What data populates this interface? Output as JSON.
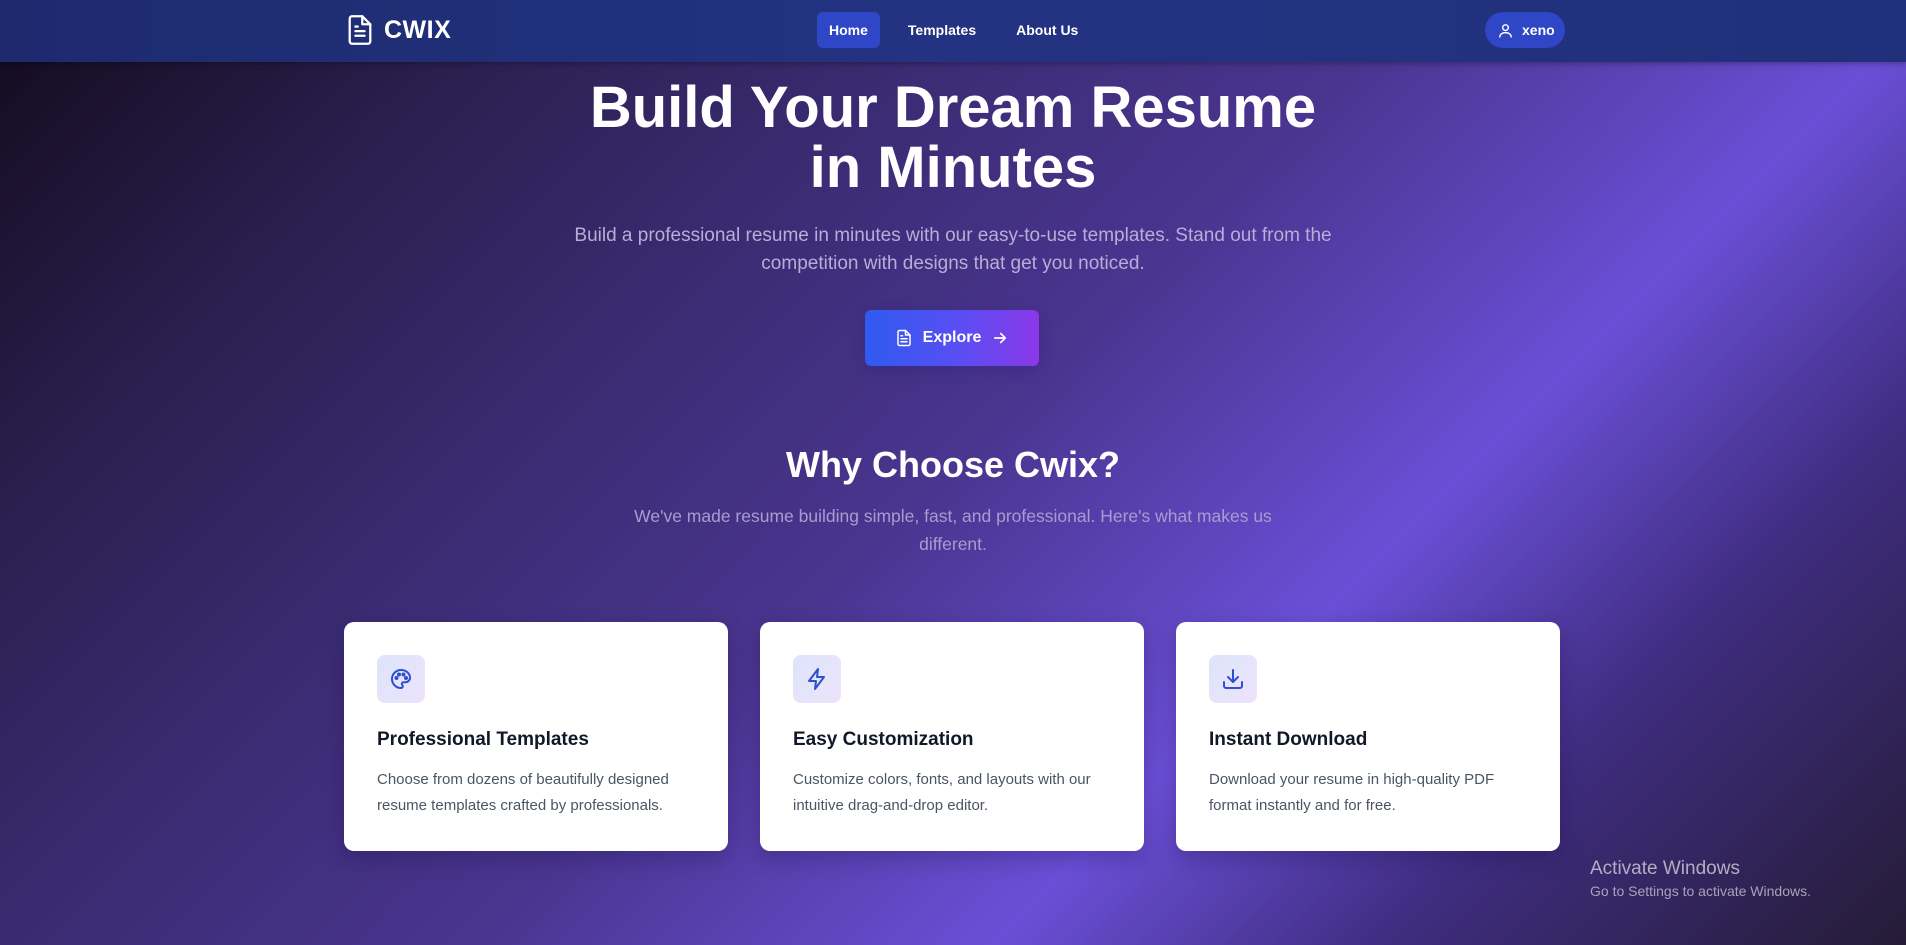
{
  "nav": {
    "brand": "CWIX",
    "links": [
      {
        "label": "Home",
        "active": true
      },
      {
        "label": "Templates",
        "active": false
      },
      {
        "label": "About Us",
        "active": false
      }
    ],
    "user": "xeno"
  },
  "hero": {
    "title_line1": "Build Your Dream Resume",
    "title_line2": "in Minutes",
    "subtitle": "Build a professional resume in minutes with our easy-to-use templates. Stand out from the competition with designs that get you noticed.",
    "cta_label": "Explore"
  },
  "why": {
    "title": "Why Choose Cwix?",
    "subtitle": "We've made resume building simple, fast, and professional. Here's what makes us different."
  },
  "features": [
    {
      "icon": "palette-icon",
      "title": "Professional Templates",
      "description": "Choose from dozens of beautifully designed resume templates crafted by professionals."
    },
    {
      "icon": "zap-icon",
      "title": "Easy Customization",
      "description": "Customize colors, fonts, and layouts with our intuitive drag-and-drop editor."
    },
    {
      "icon": "download-icon",
      "title": "Instant Download",
      "description": "Download your resume in high-quality PDF format instantly and for free."
    }
  ],
  "watermark": {
    "title": "Activate Windows",
    "subtitle": "Go to Settings to activate Windows."
  },
  "colors": {
    "nav_bg": "#1d2a6e",
    "active_link": "#2f47c7",
    "cta_start": "#2f5af0",
    "cta_end": "#8a38e8",
    "icon_accent": "#2f4fd0"
  }
}
